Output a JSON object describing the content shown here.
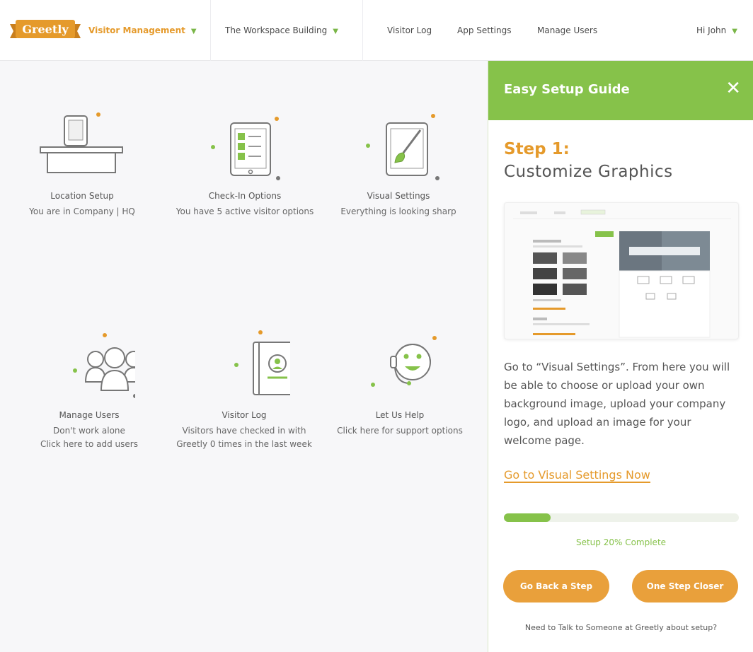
{
  "logo": {
    "text": "Greetly"
  },
  "nav": {
    "product": "Visitor Management",
    "location": "The Workspace Building",
    "links": [
      "Visitor Log",
      "App Settings",
      "Manage Users"
    ],
    "user": "Hi John"
  },
  "cards": [
    {
      "title": "Location Setup",
      "sub1": "You are in Company | HQ",
      "sub2": ""
    },
    {
      "title": "Check-In Options",
      "sub1": "You have 5 active visitor options",
      "sub2": ""
    },
    {
      "title": "Visual Settings",
      "sub1": "Everything is looking sharp",
      "sub2": ""
    },
    {
      "title": "Manage Users",
      "sub1": "Don't work alone",
      "sub2": "Click here to add users"
    },
    {
      "title": "Visitor Log",
      "sub1": "Visitors have checked in with",
      "sub2": "Greetly 0 times in the last week"
    },
    {
      "title": "Let Us Help",
      "sub1": "Click here for support options",
      "sub2": ""
    }
  ],
  "setup": {
    "title": "Easy Setup Guide",
    "close": "✕",
    "step_number": "Step 1:",
    "step_title": "Customize Graphics",
    "description": "Go to “Visual Settings”. From here you will be able to choose or upload your own background image, upload your company logo, and upload an image for your welcome page.",
    "link": "Go to Visual Settings Now",
    "progress_percent": 20,
    "progress_label": "Setup 20% Complete",
    "back_button": "Go Back a Step",
    "next_button": "One Step Closer",
    "help_link": "Need to Talk to Someone at Greetly about setup?"
  },
  "colors": {
    "brand_orange": "#e59a2b",
    "brand_green": "#86c24a"
  }
}
